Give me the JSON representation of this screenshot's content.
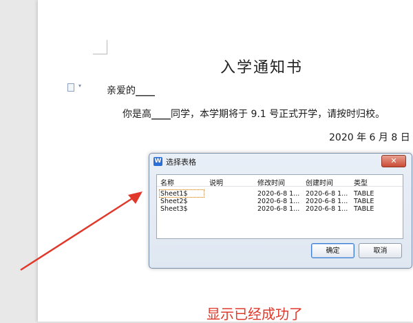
{
  "document": {
    "title": "入学通知书",
    "greeting_prefix": "亲爱的",
    "greeting_blank": "____",
    "body_prefix": "你是高",
    "body_blank": "____",
    "body_suffix": "同学，本学期将于 9.1 号正式开学，请按时归校。",
    "date": "2020 年 6 月 8 日"
  },
  "dialog": {
    "title": "选择表格",
    "close_label": "✕",
    "columns": [
      "名称",
      "说明",
      "修改时间",
      "创建时间",
      "类型"
    ],
    "rows": [
      {
        "name": "Sheet1$",
        "desc": "",
        "modified": "2020-6-8 1...",
        "created": "2020-6-8 1...",
        "type": "TABLE"
      },
      {
        "name": "Sheet2$",
        "desc": "",
        "modified": "2020-6-8 1...",
        "created": "2020-6-8 1...",
        "type": "TABLE"
      },
      {
        "name": "Sheet3$",
        "desc": "",
        "modified": "2020-6-8 1...",
        "created": "2020-6-8 1...",
        "type": "TABLE"
      }
    ],
    "ok_label": "确定",
    "cancel_label": "取消"
  },
  "annotation": {
    "caption": "显示已经成功了",
    "color": "#e0392b"
  }
}
